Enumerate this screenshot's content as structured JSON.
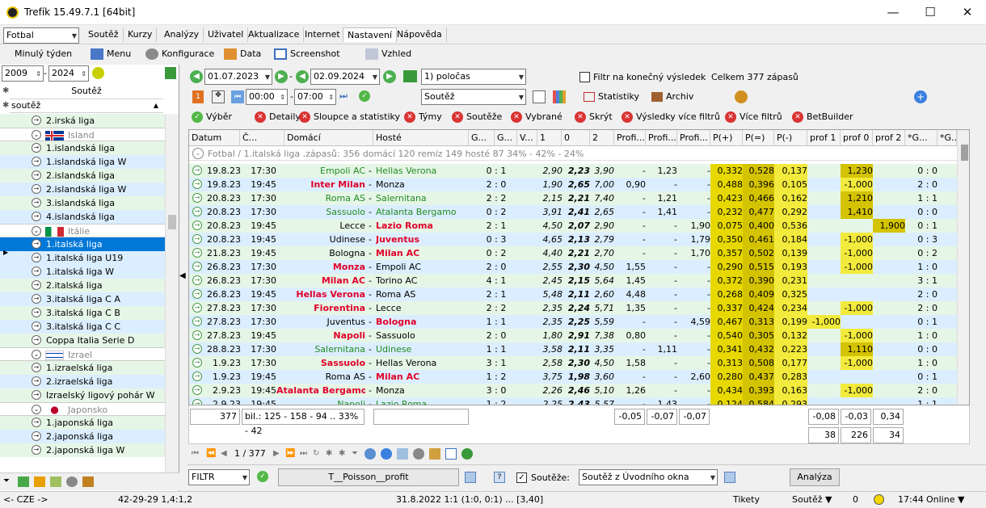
{
  "window": {
    "title": "Trefík 15.49.7.1 [64bit]",
    "min": "—",
    "max": "☐",
    "close": "✕"
  },
  "sport_select": "Fotbal",
  "menu": [
    "Soutěž",
    "Kurzy",
    "Analýzy",
    "Uživatel",
    "Aktualizace",
    "Internet",
    "Nastavení",
    "Nápověda"
  ],
  "toolbar2": {
    "period": "Minulý týden",
    "menu": "Menu",
    "konfigurace": "Konfigurace",
    "data": "Data",
    "screenshot": "Screenshot",
    "vzhled": "Vzhled"
  },
  "years": {
    "from": "2009",
    "to": "2024"
  },
  "left": {
    "header": "Soutěž",
    "filter": "soutěž",
    "rows": [
      {
        "t": "2.irská liga",
        "k": "g"
      },
      {
        "t": "Island",
        "k": "country",
        "flag": "island"
      },
      {
        "t": "1.islandská liga",
        "k": "g"
      },
      {
        "t": "1.islandská liga W",
        "k": "b"
      },
      {
        "t": "2.islandská liga",
        "k": "g"
      },
      {
        "t": "2.islandská liga W",
        "k": "b"
      },
      {
        "t": "3.islandská liga",
        "k": "g"
      },
      {
        "t": "4.islandská liga",
        "k": "b"
      },
      {
        "t": "Itálie",
        "k": "country",
        "flag": "italy"
      },
      {
        "t": "1.italská liga",
        "k": "sel"
      },
      {
        "t": "1.italská liga U19",
        "k": "b"
      },
      {
        "t": "1.italská liga W",
        "k": "b"
      },
      {
        "t": "2.italská liga",
        "k": "g"
      },
      {
        "t": "3.italská liga C A",
        "k": "b"
      },
      {
        "t": "3.italská liga C B",
        "k": "g"
      },
      {
        "t": "3.italská liga C C",
        "k": "b"
      },
      {
        "t": "Coppa Italia Serie D",
        "k": "g"
      },
      {
        "t": "Izrael",
        "k": "country",
        "flag": "israel"
      },
      {
        "t": "1.izraelská liga",
        "k": "g"
      },
      {
        "t": "2.izraelská liga",
        "k": "b"
      },
      {
        "t": "Izraelský ligový pohár W",
        "k": "g"
      },
      {
        "t": "Japonsko",
        "k": "country",
        "flag": "japan"
      },
      {
        "t": "1.japonská liga",
        "k": "g"
      },
      {
        "t": "2.japonská liga",
        "k": "b"
      },
      {
        "t": "2.japonská liga W",
        "k": "g"
      }
    ]
  },
  "filters": {
    "date_from": "01.07.2023",
    "date_to": "02.09.2024",
    "half": "1) poločas",
    "final_filter": "Filtr na konečný výsledek",
    "total": "Celkem 377 zápasů",
    "time_from": "00:00",
    "time_to": "07:00",
    "competition": "Soutěž",
    "stats": "Statistiky",
    "archive": "Archiv"
  },
  "buttons": [
    "Výběr",
    "Detaily",
    "Sloupce a statistiky",
    "Týmy",
    "Soutěže",
    "Vybrané",
    "Skrýt",
    "Výsledky více filtrů",
    "Více filtrů",
    "BetBuilder"
  ],
  "columns": [
    "Datum",
    "Č...",
    "Domácí",
    "Hosté",
    "G...",
    "G...",
    "V...",
    "1",
    "0",
    "2",
    "Profi...",
    "Profi...",
    "Profi...",
    "P(+)",
    "P(=)",
    "P(-)",
    "prof 1",
    "prof 0",
    "prof 2",
    "*G...",
    "*G..."
  ],
  "group_row": "Fotbal / 1.italská liga .zápasů: 356  domácí 120  remíz 149  hosté 87      34% - 42% - 24%",
  "rows": [
    [
      "19.8.23",
      "17:30",
      "Empoli AC",
      "Hellas Verona",
      "0 : 1",
      "2,90",
      "2,23",
      "3,90",
      "-",
      "1,23",
      "-",
      "0,332",
      "0,528",
      "0,137",
      "",
      "1,230",
      "",
      "0 : 0",
      "g",
      "g"
    ],
    [
      "19.8.23",
      "19:45",
      "Inter Milan",
      "Monza",
      "2 : 0",
      "1,90",
      "2,65",
      "7,00",
      "0,90",
      "-",
      "-",
      "0,488",
      "0,396",
      "0,105",
      "",
      "-1,000",
      "",
      "2 : 0",
      "r",
      ""
    ],
    [
      "20.8.23",
      "17:30",
      "Roma AS",
      "Salernitana",
      "2 : 2",
      "2,15",
      "2,21",
      "7,40",
      "-",
      "1,21",
      "-",
      "0,423",
      "0,466",
      "0,162",
      "",
      "1,210",
      "",
      "1 : 1",
      "g",
      "g"
    ],
    [
      "20.8.23",
      "17:30",
      "Sassuolo",
      "Atalanta Bergamo",
      "0 : 2",
      "3,91",
      "2,41",
      "2,65",
      "-",
      "1,41",
      "-",
      "0,232",
      "0,477",
      "0,292",
      "",
      "1,410",
      "",
      "0 : 0",
      "g",
      "g"
    ],
    [
      "20.8.23",
      "19:45",
      "Lecce",
      "Lazio Roma",
      "2 : 1",
      "4,50",
      "2,07",
      "2,90",
      "-",
      "-",
      "1,90",
      "0,075",
      "0,400",
      "0,536",
      "",
      "",
      "1,900",
      "0 : 1",
      "",
      "r"
    ],
    [
      "20.8.23",
      "19:45",
      "Udinese",
      "Juventus",
      "0 : 3",
      "4,65",
      "2,13",
      "2,79",
      "-",
      "-",
      "1,79",
      "0,350",
      "0,461",
      "0,184",
      "",
      "-1,000",
      "",
      "0 : 3",
      "",
      "r"
    ],
    [
      "21.8.23",
      "19:45",
      "Bologna",
      "Milan AC",
      "0 : 2",
      "4,40",
      "2,21",
      "2,70",
      "-",
      "-",
      "1,70",
      "0,357",
      "0,502",
      "0,139",
      "",
      "-1,000",
      "",
      "0 : 2",
      "",
      "r"
    ],
    [
      "26.8.23",
      "17:30",
      "Monza",
      "Empoli AC",
      "2 : 0",
      "2,55",
      "2,30",
      "4,50",
      "1,55",
      "-",
      "-",
      "0,290",
      "0,515",
      "0,193",
      "",
      "-1,000",
      "",
      "1 : 0",
      "r",
      ""
    ],
    [
      "26.8.23",
      "17:30",
      "Milan AC",
      "Torino AC",
      "4 : 1",
      "2,45",
      "2,15",
      "5,64",
      "1,45",
      "-",
      "-",
      "0,372",
      "0,390",
      "0,231",
      "",
      "",
      "",
      "3 : 1",
      "r",
      ""
    ],
    [
      "26.8.23",
      "19:45",
      "Hellas Verona",
      "Roma AS",
      "2 : 1",
      "5,48",
      "2,11",
      "2,60",
      "4,48",
      "-",
      "-",
      "0,268",
      "0,409",
      "0,325",
      "",
      "",
      "",
      "2 : 0",
      "r",
      ""
    ],
    [
      "27.8.23",
      "17:30",
      "Fiorentina",
      "Lecce",
      "2 : 2",
      "2,35",
      "2,24",
      "5,71",
      "1,35",
      "-",
      "-",
      "0,337",
      "0,424",
      "0,234",
      "",
      "-1,000",
      "",
      "2 : 0",
      "r",
      ""
    ],
    [
      "27.8.23",
      "17:30",
      "Juventus",
      "Bologna",
      "1 : 1",
      "2,35",
      "2,25",
      "5,59",
      "-",
      "-",
      "4,59",
      "0,467",
      "0,313",
      "0,199",
      "-1,000",
      "",
      "",
      "0 : 1",
      "",
      "r"
    ],
    [
      "27.8.23",
      "19:45",
      "Napoli",
      "Sassuolo",
      "2 : 0",
      "1,80",
      "2,91",
      "7,38",
      "0,80",
      "-",
      "-",
      "0,540",
      "0,305",
      "0,132",
      "",
      "-1,000",
      "",
      "1 : 0",
      "r",
      ""
    ],
    [
      "28.8.23",
      "17:30",
      "Salernitana",
      "Udinese",
      "1 : 1",
      "3,58",
      "2,11",
      "3,35",
      "-",
      "1,11",
      "-",
      "0,341",
      "0,432",
      "0,223",
      "",
      "1,110",
      "",
      "0 : 0",
      "g",
      "g"
    ],
    [
      "1.9.23",
      "17:30",
      "Sassuolo",
      "Hellas Verona",
      "3 : 1",
      "2,58",
      "2,30",
      "4,50",
      "1,58",
      "-",
      "-",
      "0,313",
      "0,508",
      "0,177",
      "",
      "-1,000",
      "",
      "1 : 0",
      "r",
      ""
    ],
    [
      "1.9.23",
      "19:45",
      "Roma AS",
      "Milan AC",
      "1 : 2",
      "3,75",
      "1,98",
      "3,60",
      "-",
      "-",
      "2,60",
      "0,280",
      "0,437",
      "0,283",
      "",
      "",
      "",
      "0 : 1",
      "",
      "r"
    ],
    [
      "2.9.23",
      "19:45",
      "Atalanta Bergamo",
      "Monza",
      "3 : 0",
      "2,26",
      "2,46",
      "5,10",
      "1,26",
      "-",
      "-",
      "0,434",
      "0,393",
      "0,163",
      "",
      "-1,000",
      "",
      "2 : 0",
      "r",
      ""
    ],
    [
      "2.9.23",
      "19:45",
      "Napoli",
      "Lazio Roma",
      "1 : 2",
      "2,25",
      "2,43",
      "5,57",
      "-",
      "1,43",
      "-",
      "0,124",
      "0,584",
      "0,293",
      "",
      "",
      "",
      "1 : 1",
      "g",
      "g"
    ]
  ],
  "summary": {
    "count": "377",
    "bil": "bil.: 125 - 158 - 94 .. 33% - 42",
    "p1": "-0,05",
    "p2": "-0,07",
    "p3": "-0,07",
    "q1": "-0,08",
    "q2": "-0,03",
    "q3": "0,34",
    "c1": "38",
    "c2": "226",
    "c3": "34"
  },
  "nav": {
    "page": "1 / 377"
  },
  "bottom": {
    "filtr": "FILTR",
    "profit": "T__Poisson__profit",
    "souteze_label": "Soutěže:",
    "souteze_value": "Soutěž z Úvodního okna",
    "analyza": "Analýza"
  },
  "status": {
    "cze": "<- CZE ->",
    "odds": "42-29-29  1,4:1,2",
    "match": "31.8.2022 1:1 (1:0, 0:1) ... [3,40]",
    "tikety": "Tikety",
    "soutez": "Soutěž ▼",
    "zero": "0",
    "time": "17:44",
    "online": "Online ▼"
  }
}
